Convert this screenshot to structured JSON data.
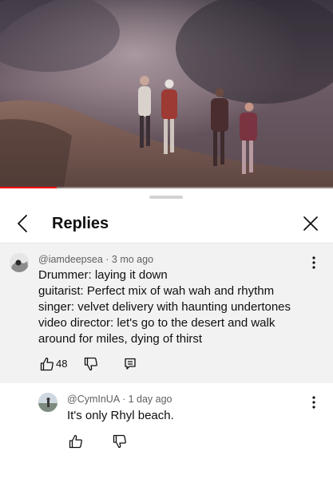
{
  "video": {
    "progress_fraction": 0.17
  },
  "sheet": {
    "title": "Replies"
  },
  "parent_comment": {
    "handle": "@iamdeepsea",
    "age": "3 mo ago",
    "meta": "@iamdeepsea · 3 mo ago",
    "lines": [
      "Drummer: laying it down",
      "guitarist: Perfect mix of wah wah and rhythm",
      "singer: velvet delivery with haunting undertones",
      "video director: let's go to the desert and walk",
      "around for miles, dying of thirst"
    ],
    "like_count": "48"
  },
  "reply": {
    "handle": "@CymInUA",
    "age": "1 day ago",
    "meta": "@CymInUA · 1 day ago",
    "text": "It's only Rhyl beach."
  },
  "colors": {
    "progress": "#ff0000",
    "parent_bg": "#f2f2f2",
    "meta_text": "#606060"
  },
  "icons": {
    "back": "chevron-left-icon",
    "close": "close-icon",
    "menu": "more-vertical-icon",
    "like": "thumbs-up-icon",
    "dislike": "thumbs-down-icon",
    "reply": "comment-icon"
  }
}
